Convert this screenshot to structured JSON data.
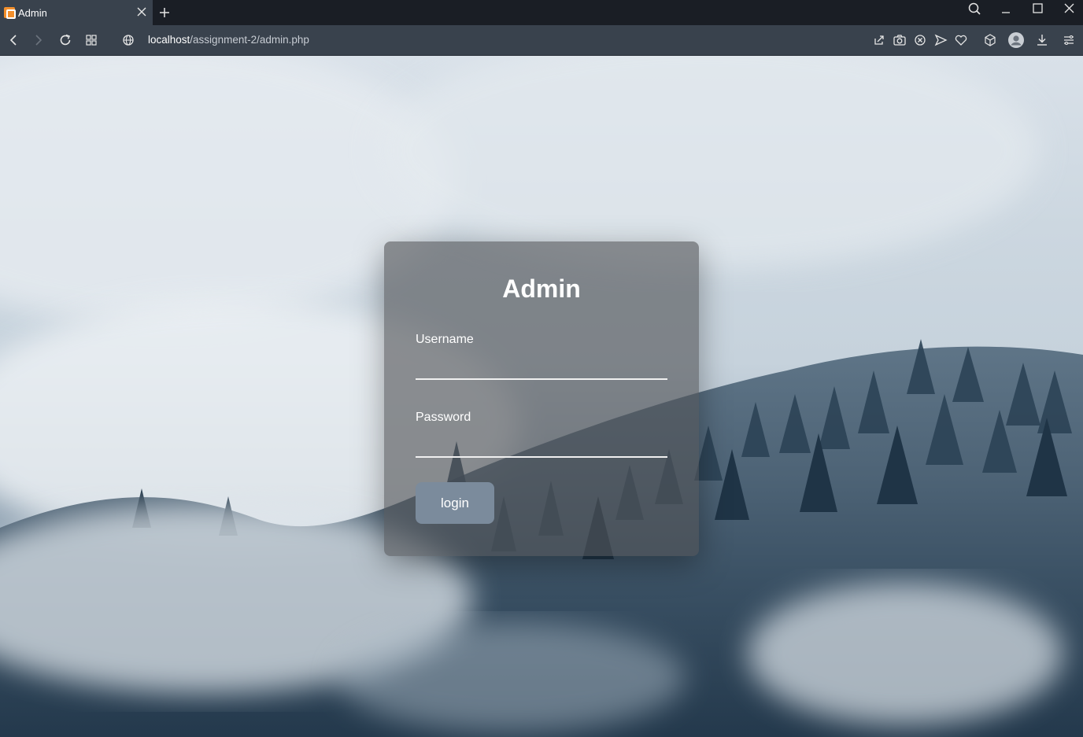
{
  "browser": {
    "tab_title": "Admin",
    "url_host": "localhost",
    "url_path": "/assignment-2/admin.php"
  },
  "login": {
    "heading": "Admin",
    "username_label": "Username",
    "password_label": "Password",
    "button_label": "login"
  },
  "colors": {
    "accent_button": "#7b8b9c",
    "card_background": "rgba(80,82,86,0.62)",
    "chrome_dark": "#1a1e25",
    "chrome_toolbar": "#39424d"
  }
}
